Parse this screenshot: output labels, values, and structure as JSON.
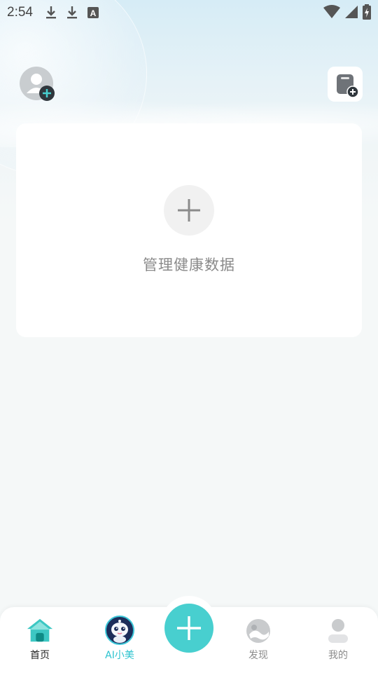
{
  "status_bar": {
    "time": "2:54",
    "icons_left": [
      "download-icon",
      "download-icon",
      "text-a-icon"
    ],
    "icons_right": [
      "wifi-icon",
      "signal-icon",
      "battery-charging-icon"
    ]
  },
  "header": {
    "avatar_icon": "user-add-icon",
    "device_icon": "device-add-icon"
  },
  "card": {
    "add_icon": "plus-icon",
    "label": "管理健康数据"
  },
  "bottom_nav": {
    "items": [
      {
        "label": "首页",
        "icon": "home-icon",
        "active": true
      },
      {
        "label": "AI小美",
        "icon": "ai-robot-icon",
        "active": false
      },
      {
        "label": "发现",
        "icon": "discover-icon",
        "active": false
      },
      {
        "label": "我的",
        "icon": "profile-icon",
        "active": false
      }
    ],
    "center_icon": "plus-icon"
  },
  "colors": {
    "accent": "#48cfcf",
    "ai_label": "#2bc3cf",
    "home_icon": "#3cc7c3"
  }
}
